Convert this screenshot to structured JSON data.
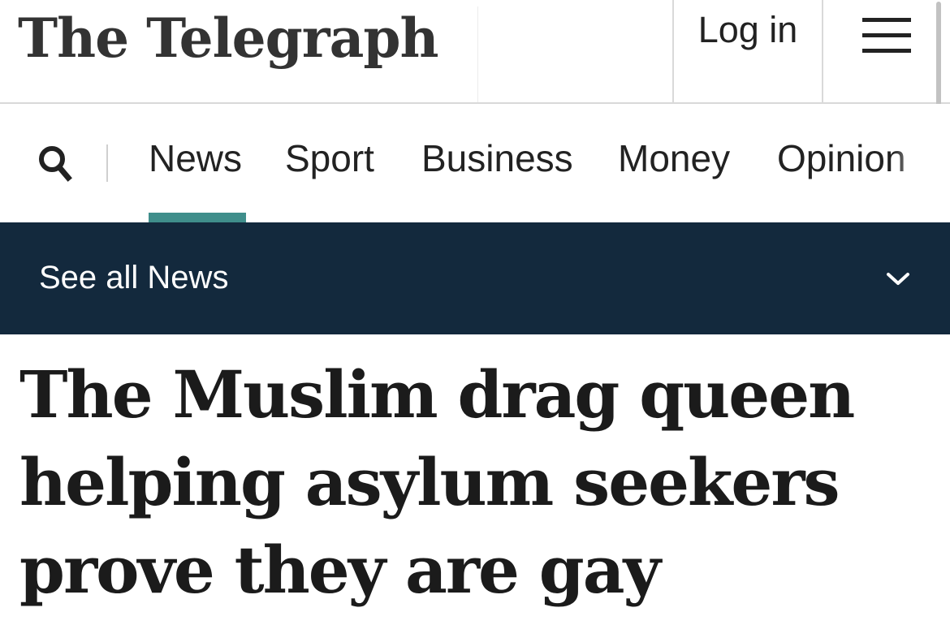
{
  "header": {
    "masthead": "The Telegraph",
    "login_label": "Log in",
    "menu_icon": "hamburger-menu-icon"
  },
  "nav": {
    "search_icon": "search-icon",
    "items": [
      {
        "label": "News",
        "active": true
      },
      {
        "label": "Sport",
        "active": false
      },
      {
        "label": "Business",
        "active": false
      },
      {
        "label": "Money",
        "active": false
      },
      {
        "label": "Opinion",
        "active": false
      }
    ],
    "active_color": "#3f8e8b"
  },
  "subnav": {
    "label": "See all News",
    "icon": "chevron-down-icon",
    "background": "#13293d"
  },
  "article": {
    "headline": "The Muslim drag queen helping asylum seekers prove they are gay"
  }
}
